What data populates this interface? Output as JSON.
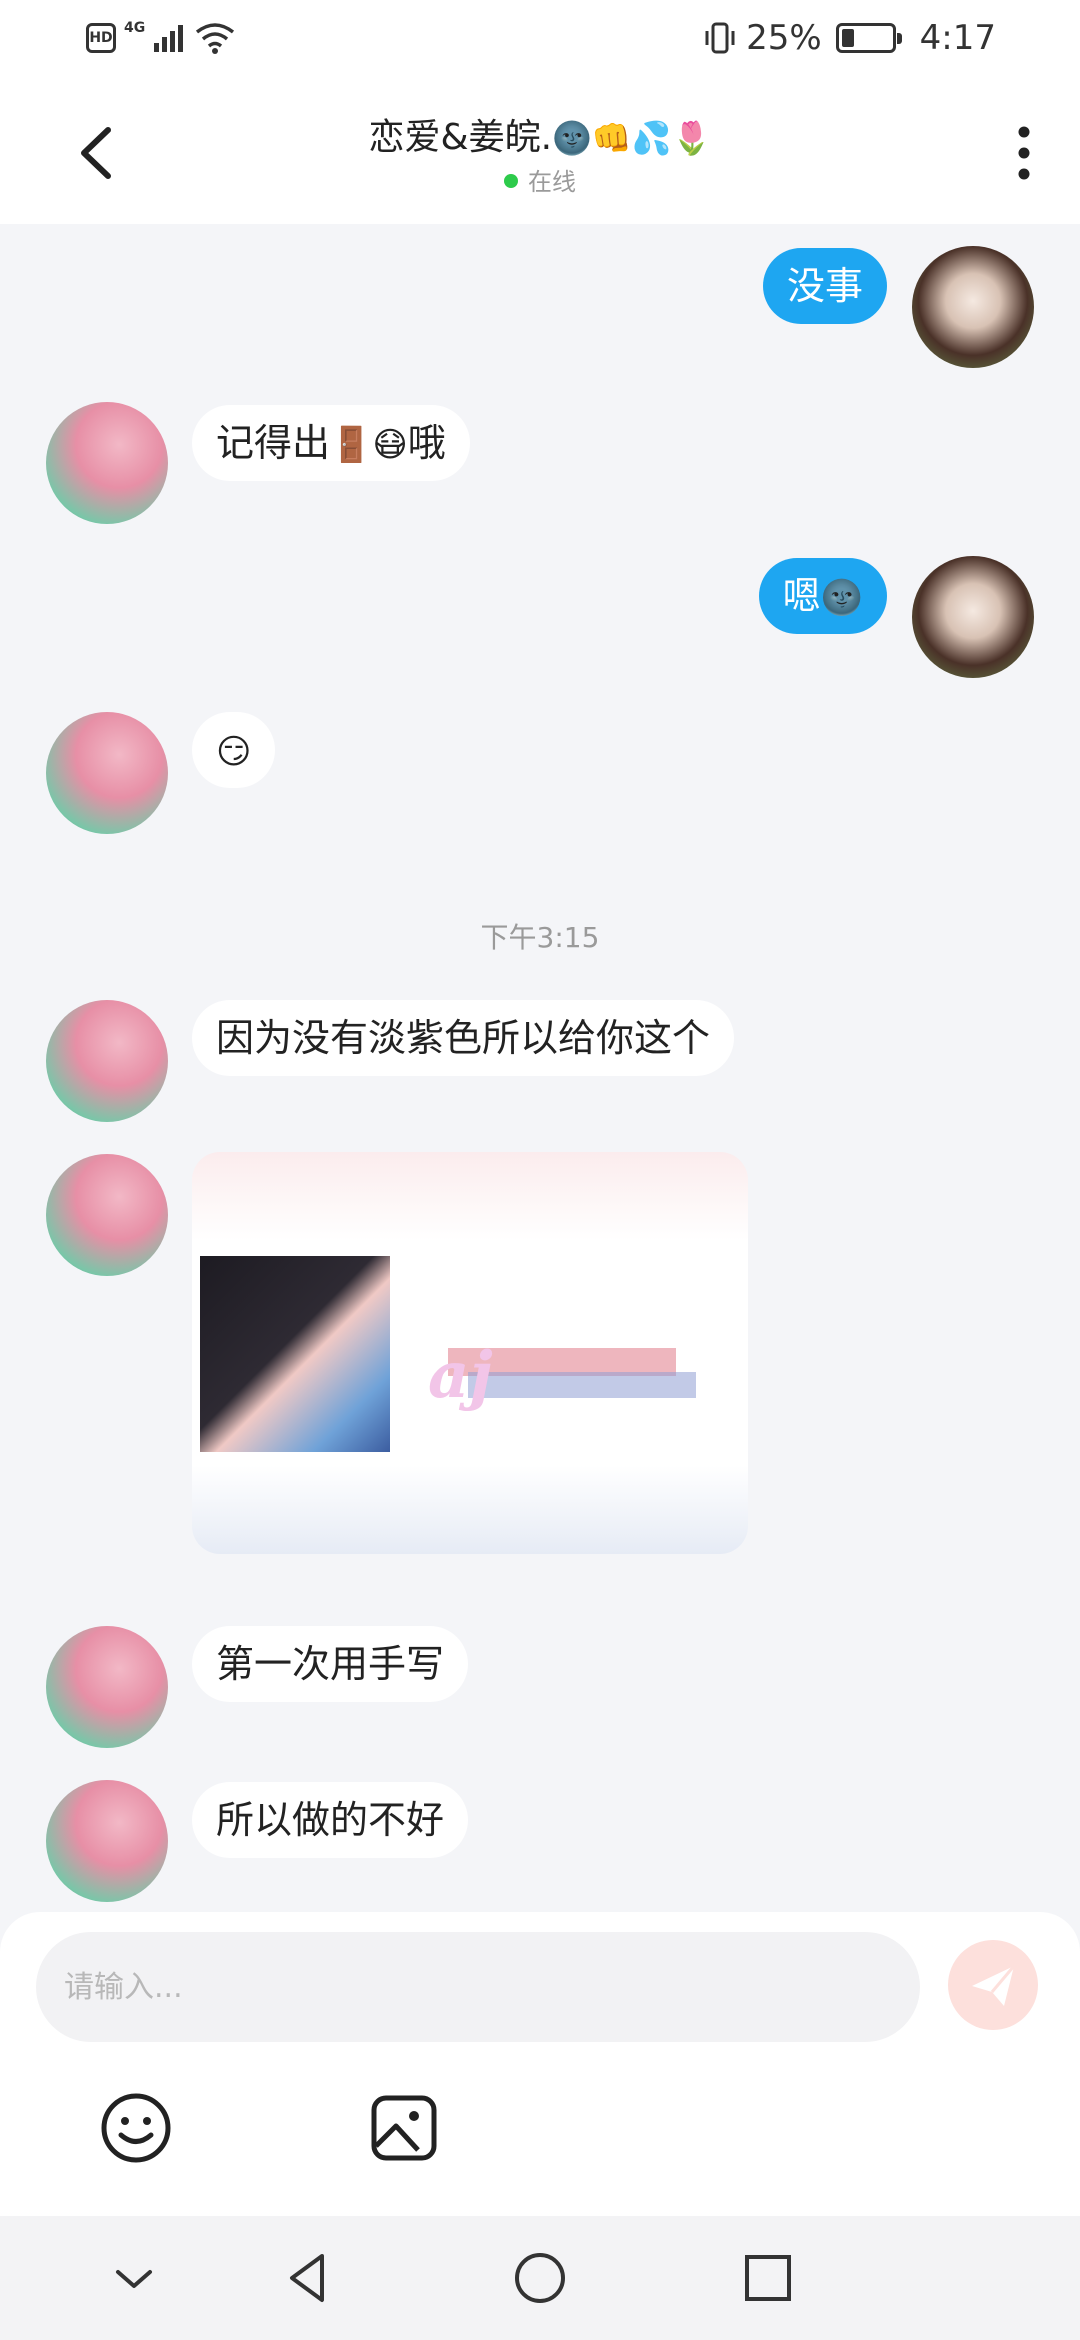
{
  "status_bar": {
    "network_badge": "HD",
    "signal_label": "4G",
    "battery_percent": "25%",
    "battery_level": 0.25,
    "time": "4:17"
  },
  "header": {
    "title": "恋爱&姜皖.",
    "title_emojis": "🌚👊💦🌷",
    "status": "在线",
    "status_color": "#2dcb4b",
    "back_icon": "chevron-left-icon",
    "more_icon": "more-vertical-icon"
  },
  "messages": [
    {
      "side": "self",
      "text": "没事"
    },
    {
      "side": "other",
      "text": "记得出",
      "emoji": "🚪😷",
      "text_after": "哦"
    },
    {
      "side": "self",
      "text": "嗯",
      "emoji": "🌚"
    },
    {
      "side": "other",
      "emoji": "😏"
    },
    {
      "side": "other",
      "text": "因为没有淡紫色所以给你这个"
    },
    {
      "side": "other",
      "type": "image",
      "image_text": "aj"
    },
    {
      "side": "other",
      "text": "第一次用手写"
    },
    {
      "side": "other",
      "text": "所以做的不好"
    }
  ],
  "timestamp": "下午3:15",
  "input": {
    "placeholder": "请输入...",
    "value": "",
    "send_icon": "send-icon",
    "emoji_icon": "smiley-icon",
    "image_icon": "image-icon"
  },
  "nav": {
    "icons": [
      "hide-keyboard-icon",
      "back-triangle-icon",
      "home-circle-icon",
      "recents-square-icon"
    ]
  },
  "colors": {
    "self_bubble": "#1ea6f1",
    "other_bubble": "#ffffff",
    "chat_bg": "#f4f5f8",
    "send_button": "#fde0dc"
  }
}
